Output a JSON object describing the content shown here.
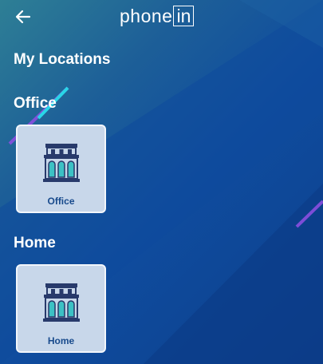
{
  "header": {
    "back_icon": "arrow-left-icon",
    "brand_prefix": "phone",
    "brand_box": "in"
  },
  "page": {
    "title": "My Locations"
  },
  "sections": [
    {
      "title": "Office",
      "card": {
        "label": "Office",
        "icon": "building-icon"
      }
    },
    {
      "title": "Home",
      "card": {
        "label": "Home",
        "icon": "building-icon"
      }
    }
  ],
  "colors": {
    "card_bg": "#c8d7ea",
    "card_label": "#184a8c",
    "icon_teal": "#3cc1c4",
    "icon_dark": "#283a6b",
    "accent_purple": "#8a4fe0",
    "accent_cyan": "#29d6e8"
  }
}
